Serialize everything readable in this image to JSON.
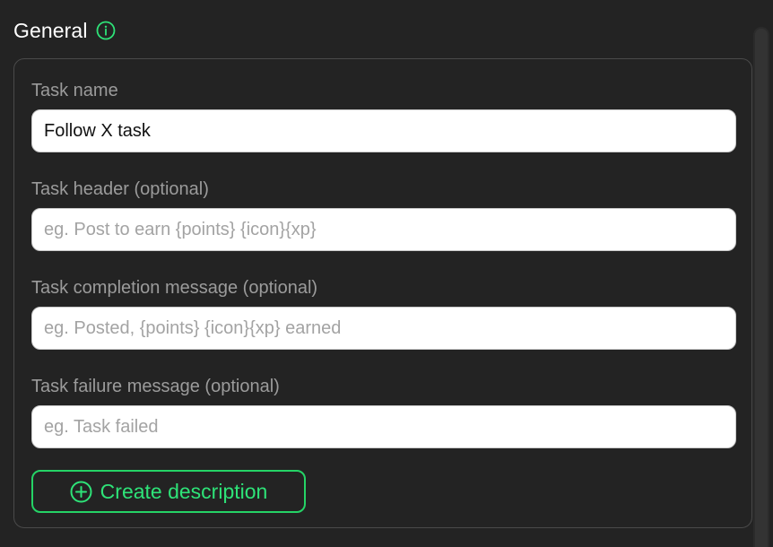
{
  "section": {
    "title": "General",
    "info_icon": "info-circle-icon"
  },
  "form": {
    "task_name": {
      "label": "Task name",
      "value": "Follow X task",
      "placeholder": ""
    },
    "task_header": {
      "label": "Task header (optional)",
      "value": "",
      "placeholder": "eg. Post to earn {points} {icon}{xp}"
    },
    "completion_message": {
      "label": "Task completion message (optional)",
      "value": "",
      "placeholder": "eg. Posted, {points} {icon}{xp} earned"
    },
    "failure_message": {
      "label": "Task failure message (optional)",
      "value": "",
      "placeholder": "eg. Task failed"
    },
    "create_description": {
      "label": "Create description",
      "icon": "plus-circle-icon"
    }
  },
  "colors": {
    "background": "#232323",
    "accent": "#2ee378",
    "border": "#4a4a4a",
    "label": "#9b9b9b"
  }
}
